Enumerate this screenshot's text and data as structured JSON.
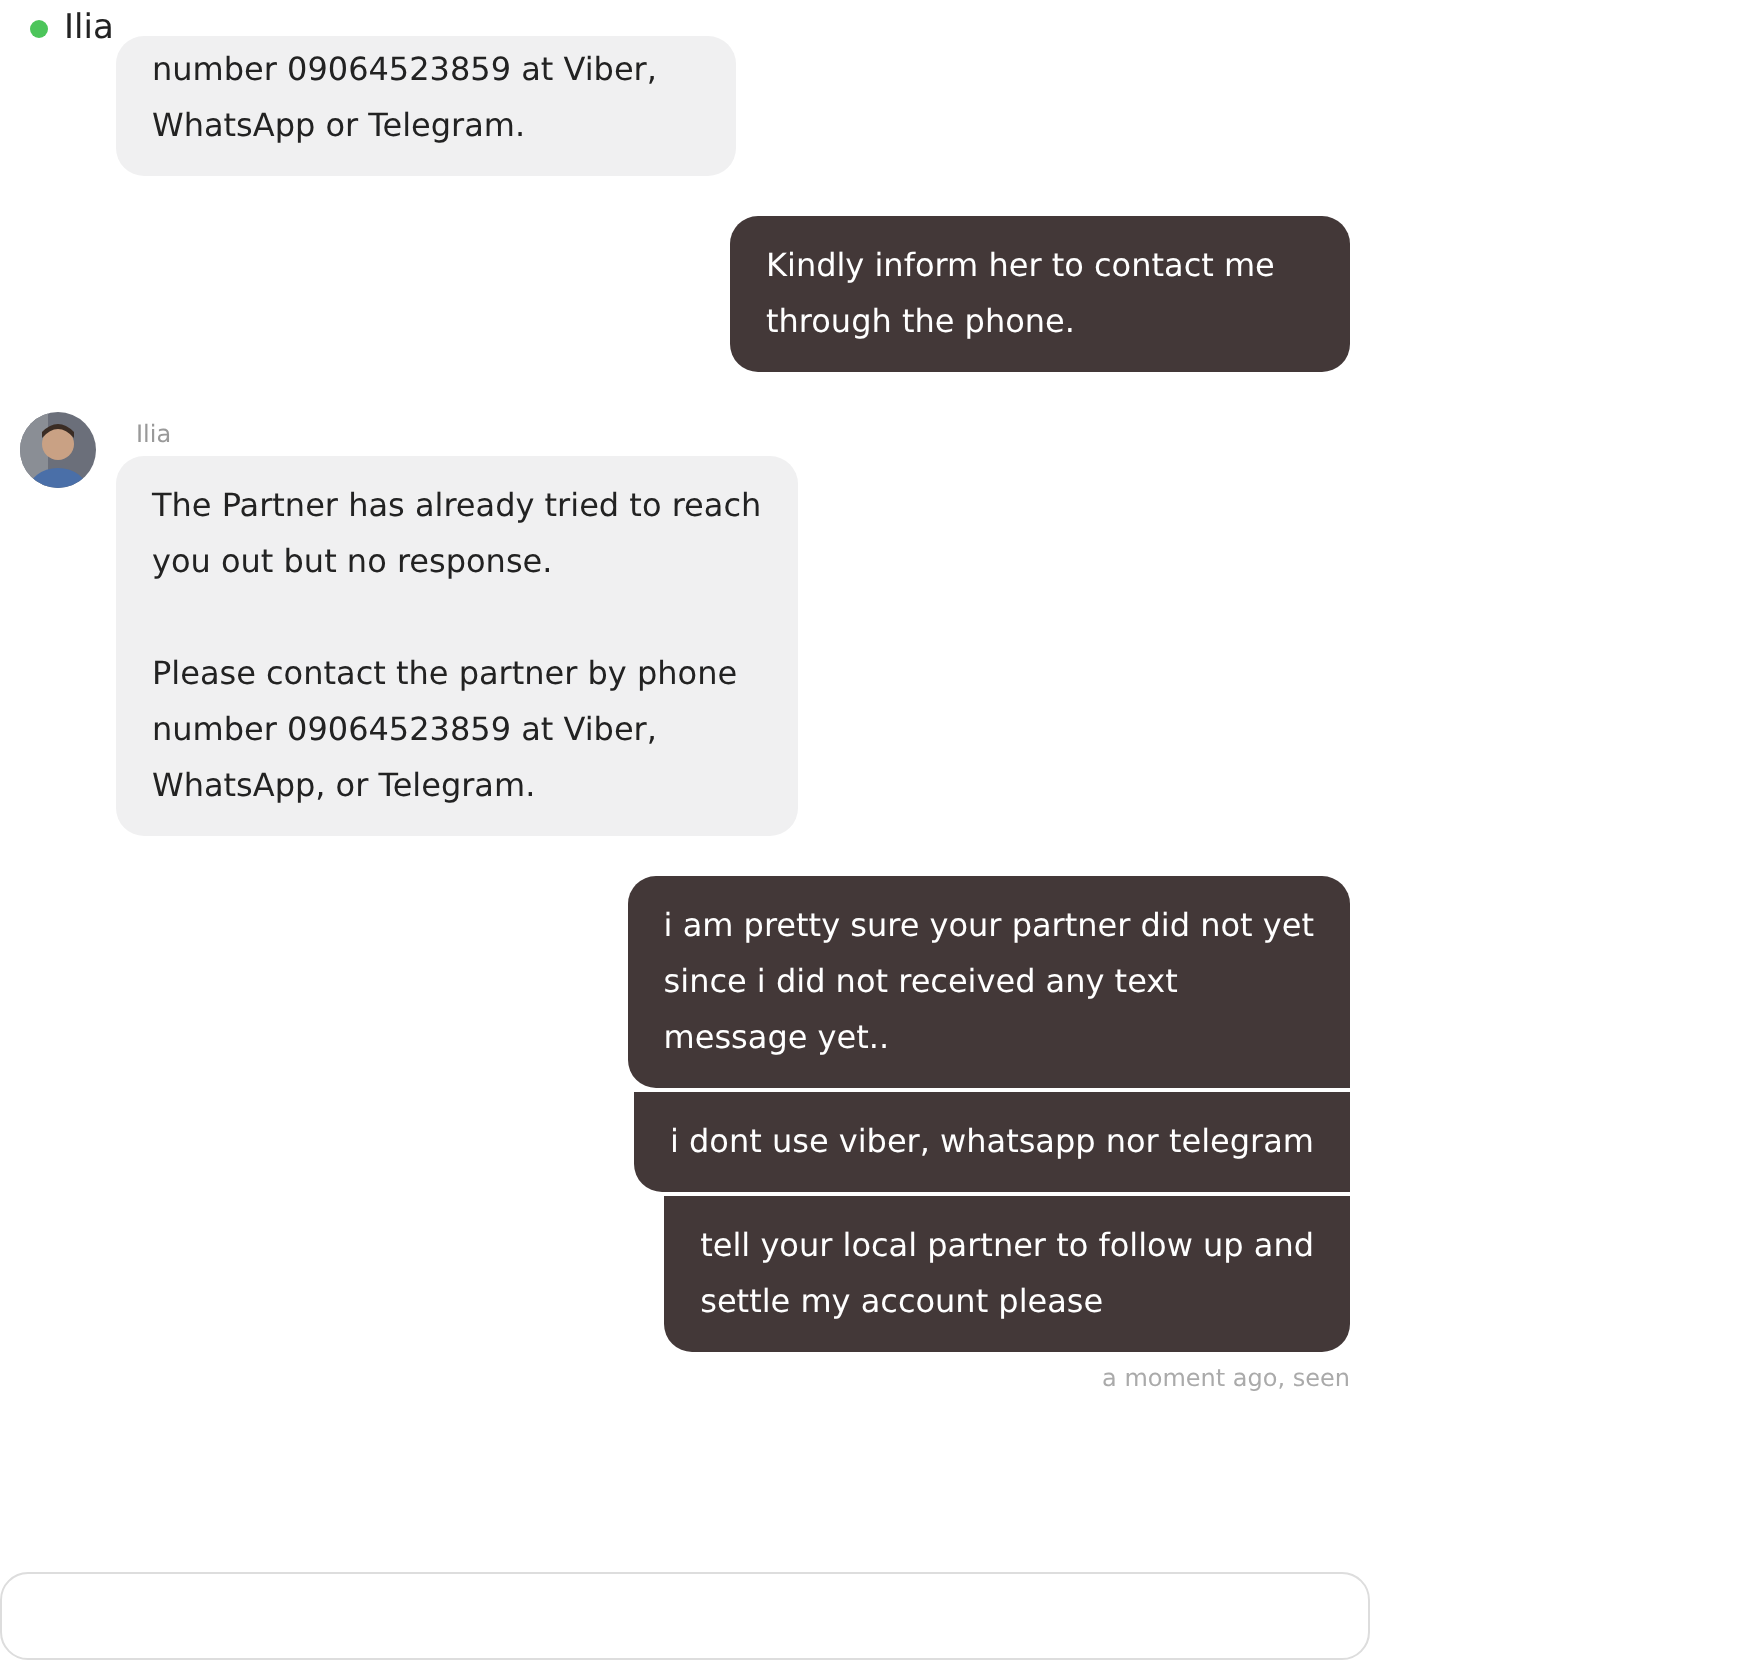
{
  "header": {
    "name": "Ilia",
    "online": true
  },
  "messages": [
    {
      "kind": "incoming",
      "paragraphs": [
        [
          "number 09064523859 at Viber,",
          "WhatsApp or Telegram."
        ]
      ]
    },
    {
      "kind": "outgoing",
      "paragraphs": [
        [
          "Kindly inform her to contact me",
          "through the phone."
        ]
      ]
    },
    {
      "kind": "incoming",
      "sender": "Ilia",
      "avatar": {
        "kind": "picture"
      },
      "paragraphs": [
        [
          "The Partner has already tried to reach",
          "you out but no response."
        ],
        [
          "Please contact the partner by phone",
          "number 09064523859 at Viber,",
          "WhatsApp, or Telegram."
        ]
      ]
    },
    {
      "kind": "outgoing",
      "paragraphs": [
        [
          "i am pretty sure your partner did not yet",
          "since i did not received any text",
          "message yet.."
        ]
      ]
    },
    {
      "kind": "outgoing",
      "paragraphs": [
        [
          "i dont use viber, whatsapp nor telegram"
        ]
      ]
    },
    {
      "kind": "outgoing",
      "paragraphs": [
        [
          "tell your local partner to follow up and",
          "settle my account please"
        ]
      ]
    }
  ],
  "status": "a moment ago, seen",
  "composer": {
    "kind": "input"
  }
}
